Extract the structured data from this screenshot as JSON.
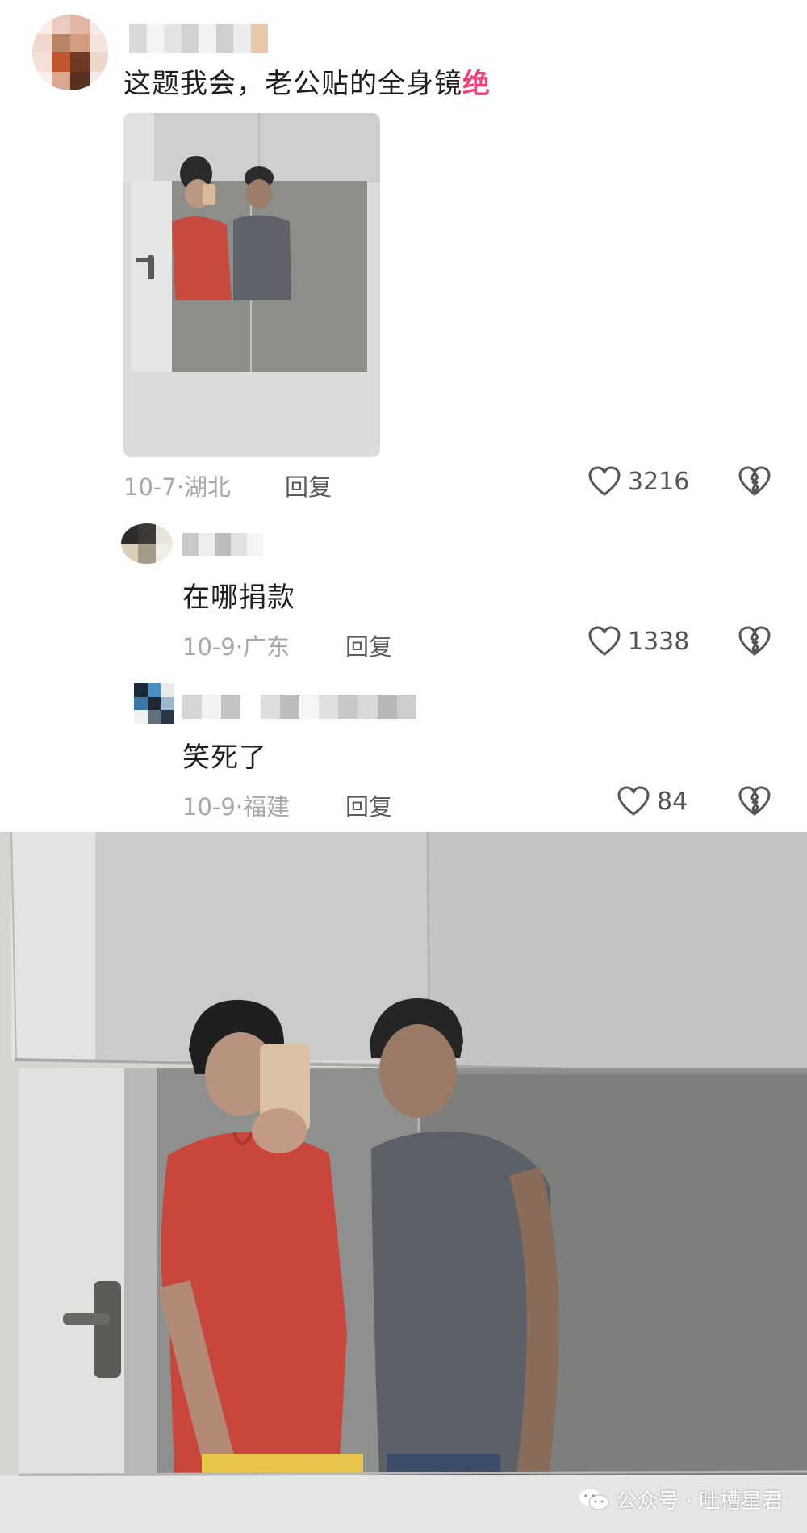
{
  "comments": [
    {
      "text_main": "这题我会，老公贴的全身镜",
      "text_emph": "绝",
      "date_location": "10-7·湖北",
      "reply_label": "回复",
      "likes": "3216"
    },
    {
      "text": "在哪捐款",
      "date_location": "10-9·广东",
      "reply_label": "回复",
      "likes": "1338"
    },
    {
      "text": "笑死了",
      "date_location": "10-9·福建",
      "reply_label": "回复",
      "likes": "84"
    }
  ],
  "watermark": "公众号 · 吐槽星君",
  "icons": {
    "like": "heart-outline-icon",
    "dislike": "broken-heart-icon",
    "wechat": "wechat-icon"
  },
  "colors": {
    "emphasis": "#f0407a",
    "meta": "#a8a8a8"
  }
}
